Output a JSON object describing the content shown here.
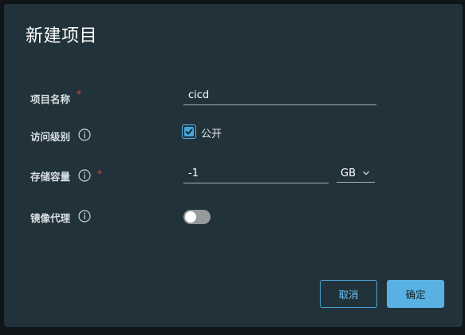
{
  "dialog": {
    "title": "新建项目"
  },
  "form": {
    "project_name": {
      "label": "项目名称",
      "required_mark": "*",
      "value": "cicd"
    },
    "access_level": {
      "label": "访问级别",
      "info_icon": "info-icon",
      "public_label": "公开",
      "public_checked": true
    },
    "storage_quota": {
      "label": "存储容量",
      "info_icon": "info-icon",
      "required_mark": "*",
      "value": "-1",
      "unit": "GB"
    },
    "mirror_proxy": {
      "label": "镜像代理",
      "info_icon": "info-icon",
      "enabled": false
    }
  },
  "buttons": {
    "cancel": "取消",
    "confirm": "确定"
  },
  "colors": {
    "dialog_bg": "#21323b",
    "accent": "#58b1e2",
    "required": "#e0483f"
  }
}
